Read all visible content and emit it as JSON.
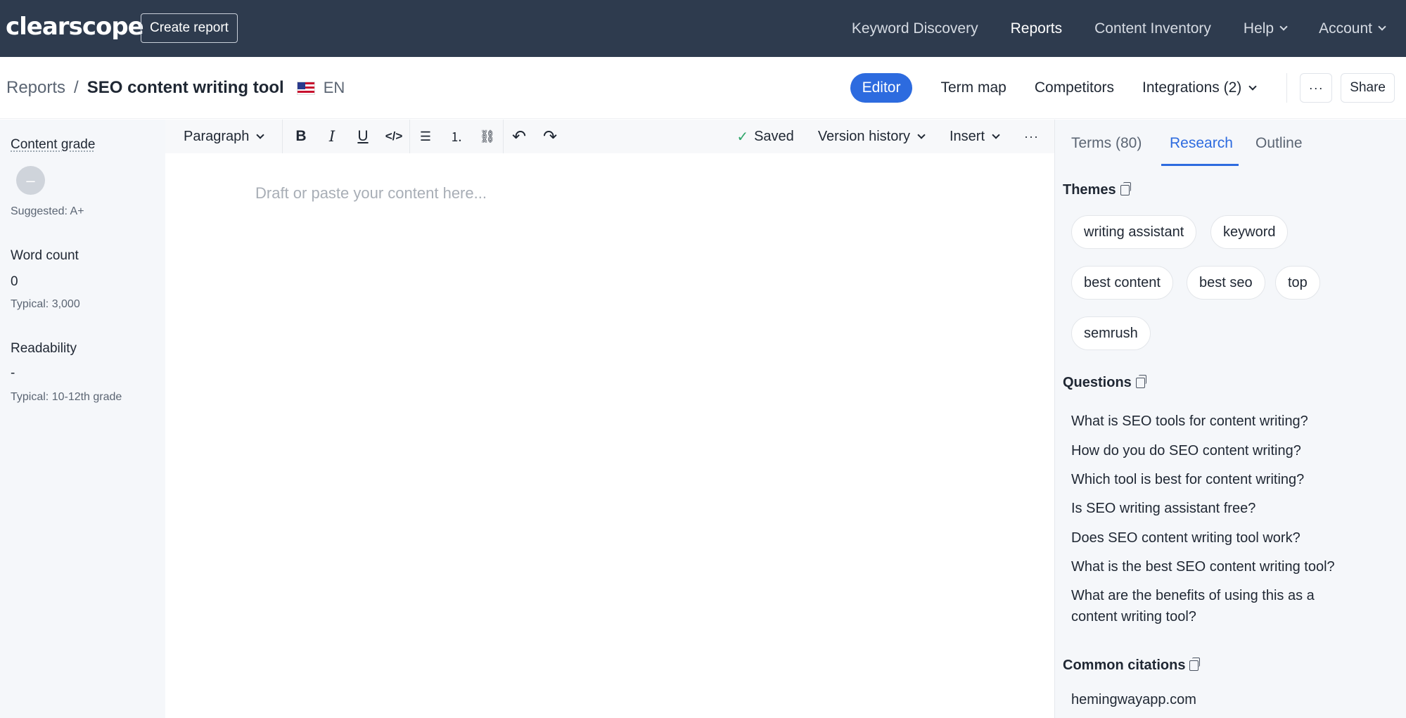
{
  "topnav": {
    "logo": "clearscope",
    "create_report": "Create report",
    "links": [
      "Keyword Discovery",
      "Reports",
      "Content Inventory",
      "Help",
      "Account"
    ]
  },
  "subheader": {
    "breadcrumb_root": "Reports",
    "breadcrumb_sep": "/",
    "report_title": "SEO content writing tool",
    "language": "EN",
    "tabs": [
      "Editor",
      "Term map",
      "Competitors",
      "Integrations (2)"
    ],
    "more": "···",
    "share": "Share"
  },
  "metrics": {
    "content_grade_label": "Content grade",
    "content_grade_value": "–",
    "suggested": "Suggested: A+",
    "word_count_label": "Word count",
    "word_count_value": "0",
    "word_count_typical": "Typical: 3,000",
    "readability_label": "Readability",
    "readability_value": "-",
    "readability_typical": "Typical: 10-12th grade"
  },
  "toolbar": {
    "paragraph": "Paragraph",
    "saved": "Saved",
    "version_history": "Version history",
    "insert": "Insert",
    "more": "···",
    "icons": {
      "bold": "B",
      "italic": "I",
      "underline": "U",
      "code": "</>",
      "bullet_list": "☰",
      "numbered_list": "⒈",
      "link": "⛓",
      "undo": "↶",
      "redo": "↷"
    }
  },
  "editor": {
    "placeholder": "Draft or paste your content here..."
  },
  "panel": {
    "tabs": [
      "Terms (80)",
      "Research",
      "Outline"
    ],
    "themes_title": "Themes",
    "themes": [
      "writing assistant",
      "keyword",
      "best content",
      "best seo",
      "top",
      "semrush"
    ],
    "questions_title": "Questions",
    "questions": [
      "What is SEO tools for content writing?",
      "How do you do SEO content writing?",
      "Which tool is best for content writing?",
      "Is SEO writing assistant free?",
      "Does SEO content writing tool work?",
      "What is the best SEO content writing tool?",
      "What are the benefits of using this as a content writing tool?"
    ],
    "citations_title": "Common citations",
    "citations": [
      "hemingwayapp.com"
    ]
  },
  "colors": {
    "nav_bg": "#2e3b4e",
    "accent": "#2d6bdf",
    "sidebar_bg": "#f5f7fa",
    "saved_check": "#2fa66a"
  }
}
